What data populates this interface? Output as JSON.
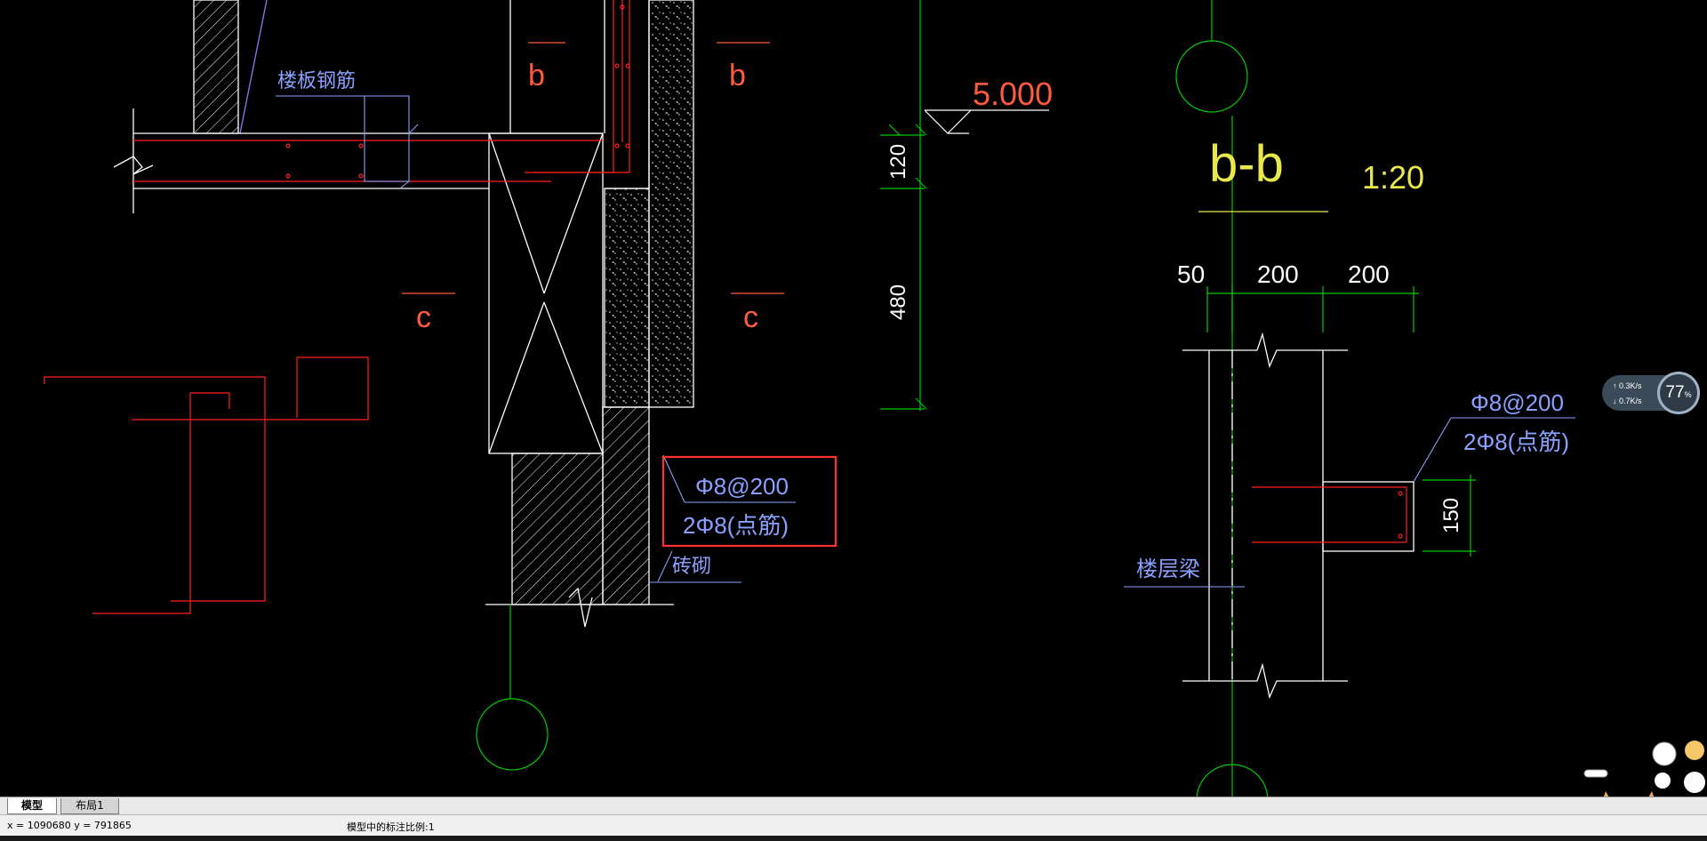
{
  "drawing": {
    "labels": {
      "slab_rebar": "楼板钢筋",
      "section_b_left": "b",
      "section_b_right": "b",
      "section_c_left": "c",
      "section_c_right": "c",
      "rebar_spec_1": "Φ8@200",
      "rebar_spec_2": "2Φ8(点筋)",
      "masonry": "砖砌",
      "elevation_value": "5.000",
      "dim_120": "120",
      "dim_480": "480",
      "section_title": "b-b",
      "section_scale": "1:20",
      "dim_50": "50",
      "dim_200a": "200",
      "dim_200b": "200",
      "right_rebar_spec_1": "Φ8@200",
      "right_rebar_spec_2": "2Φ8(点筋)",
      "dim_150": "150",
      "floor_beam": "楼层梁"
    },
    "colors": {
      "background": "#000000",
      "outline": "#ffffff",
      "rebar": "#ff2020",
      "axis": "#00cc00",
      "annotation": "#8aa0ff",
      "section_mark": "#ff5a3c",
      "title": "#e8e84a",
      "highlight_box": "#ff3030"
    }
  },
  "tabs": [
    {
      "label": "模型",
      "active": true
    },
    {
      "label": "布局1",
      "active": false
    }
  ],
  "status": {
    "coords": "x = 1090680  y = 791865",
    "scale_text": "模型中的标注比例:1"
  },
  "widget": {
    "upload": "0.3K/s",
    "download": "0.7K/s",
    "percent": "77",
    "percent_unit": "%"
  }
}
